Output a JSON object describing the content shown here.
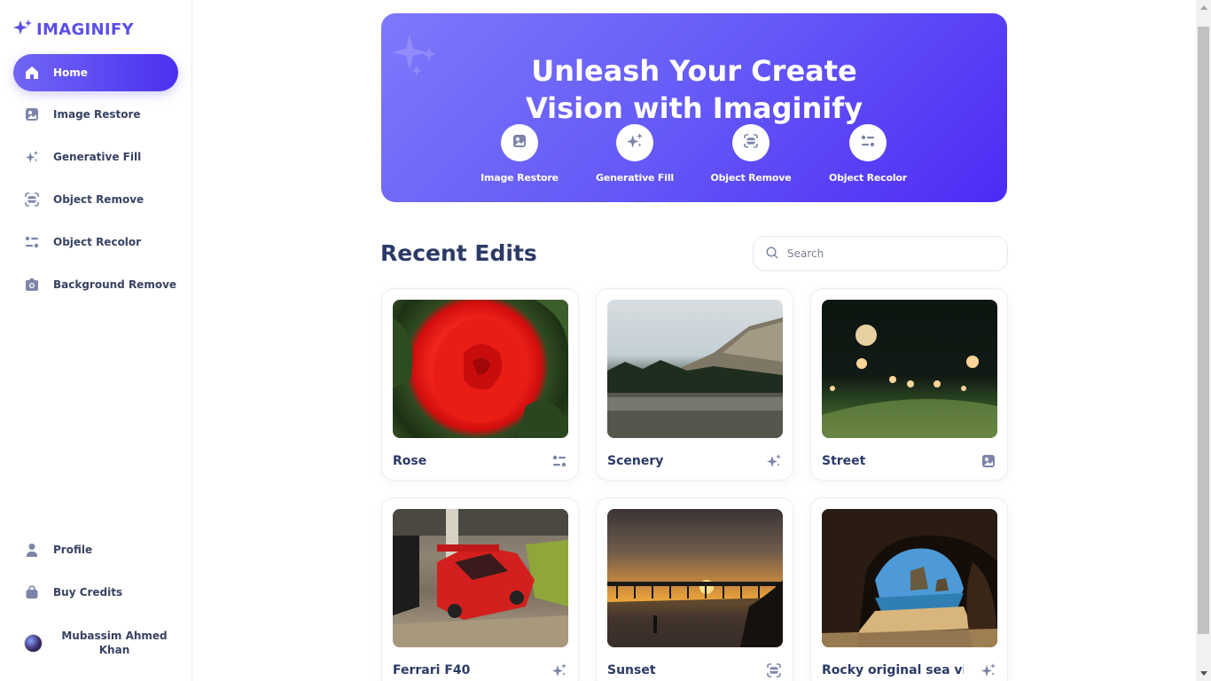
{
  "app": {
    "name": "IMAGINIFY"
  },
  "sidebar": {
    "items": [
      {
        "label": "Home",
        "icon": "home-icon",
        "active": true
      },
      {
        "label": "Image Restore",
        "icon": "image-icon"
      },
      {
        "label": "Generative Fill",
        "icon": "sparkles-icon"
      },
      {
        "label": "Object Remove",
        "icon": "scan-icon"
      },
      {
        "label": "Object Recolor",
        "icon": "filter-icon"
      },
      {
        "label": "Background Remove",
        "icon": "camera-icon"
      }
    ],
    "bottom": [
      {
        "label": "Profile",
        "icon": "user-icon"
      },
      {
        "label": "Buy Credits",
        "icon": "bag-icon"
      }
    ],
    "user": {
      "name": "Mubassim Ahmed Khan"
    }
  },
  "hero": {
    "title_line1": "Unleash Your Create",
    "title_line2": "Vision with Imaginify",
    "actions": [
      {
        "label": "Image Restore",
        "icon": "image-icon"
      },
      {
        "label": "Generative Fill",
        "icon": "sparkles-icon"
      },
      {
        "label": "Object Remove",
        "icon": "scan-icon"
      },
      {
        "label": "Object Recolor",
        "icon": "filter-icon"
      }
    ]
  },
  "recent": {
    "title": "Recent Edits",
    "search_placeholder": "Search",
    "cards": [
      {
        "name": "Rose",
        "icon": "filter-icon"
      },
      {
        "name": "Scenery",
        "icon": "sparkles-icon"
      },
      {
        "name": "Street",
        "icon": "image-icon"
      },
      {
        "name": "Ferrari F40",
        "icon": "sparkles-icon"
      },
      {
        "name": "Sunset",
        "icon": "scan-icon"
      },
      {
        "name": "Rocky original sea vie...",
        "icon": "sparkles-icon"
      }
    ]
  },
  "colors": {
    "accent": "#5b4ee8",
    "text": "#384262",
    "heading": "#2b3a67",
    "icon": "#7c85a8"
  }
}
